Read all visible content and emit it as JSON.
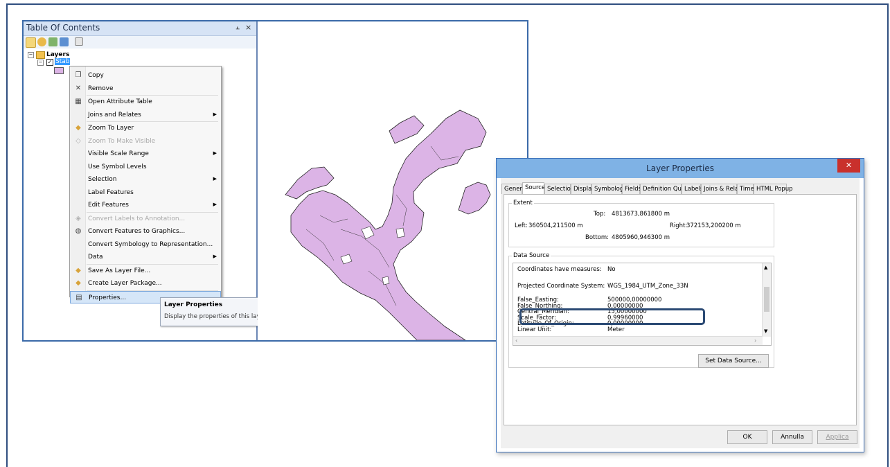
{
  "toc": {
    "title": "Table Of Contents",
    "pin_glyph": "■",
    "close_glyph": "×",
    "layers_label": "Layers",
    "layer_name": "Stab"
  },
  "context_menu": {
    "items": [
      {
        "label": "Copy",
        "icon": "copy-icon",
        "arrow": false,
        "disabled": false
      },
      {
        "label": "Remove",
        "icon": "remove-icon",
        "arrow": false,
        "disabled": false
      },
      {
        "label": "Open Attribute Table",
        "icon": "table-icon",
        "arrow": false,
        "disabled": false
      },
      {
        "label": "Joins and Relates",
        "icon": "",
        "arrow": true,
        "disabled": false
      },
      {
        "label": "Zoom To Layer",
        "icon": "zoom-layer-icon",
        "arrow": false,
        "disabled": false
      },
      {
        "label": "Zoom To Make Visible",
        "icon": "zoom-visible-icon",
        "arrow": false,
        "disabled": true
      },
      {
        "label": "Visible Scale Range",
        "icon": "",
        "arrow": true,
        "disabled": false
      },
      {
        "label": "Use Symbol Levels",
        "icon": "",
        "arrow": false,
        "disabled": false
      },
      {
        "label": "Selection",
        "icon": "",
        "arrow": true,
        "disabled": false
      },
      {
        "label": "Label Features",
        "icon": "",
        "arrow": false,
        "disabled": false
      },
      {
        "label": "Edit Features",
        "icon": "",
        "arrow": true,
        "disabled": false
      },
      {
        "label": "Convert Labels to Annotation...",
        "icon": "convert-labels-icon",
        "arrow": false,
        "disabled": true
      },
      {
        "label": "Convert Features to Graphics...",
        "icon": "convert-features-icon",
        "arrow": false,
        "disabled": false
      },
      {
        "label": "Convert Symbology to Representation...",
        "icon": "",
        "arrow": false,
        "disabled": false
      },
      {
        "label": "Data",
        "icon": "",
        "arrow": true,
        "disabled": false
      },
      {
        "label": "Save As Layer File...",
        "icon": "save-layer-icon",
        "arrow": false,
        "disabled": false
      },
      {
        "label": "Create Layer Package...",
        "icon": "layer-package-icon",
        "arrow": false,
        "disabled": false
      },
      {
        "label": "Properties...",
        "icon": "properties-icon",
        "arrow": false,
        "disabled": false
      }
    ]
  },
  "tooltip": {
    "title": "Layer Properties",
    "text": "Display the properties of this layer"
  },
  "dialog": {
    "title": "Layer Properties",
    "close_glyph": "✕",
    "tabs": [
      "General",
      "Source",
      "Selection",
      "Display",
      "Symbology",
      "Fields",
      "Definition Query",
      "Labels",
      "Joins & Relates",
      "Time",
      "HTML Popup"
    ],
    "active_tab": "Source",
    "extent": {
      "label": "Extent",
      "top_label": "Top:",
      "top": "4813673,861800 m",
      "left_label": "Left:",
      "left": "360504,211500 m",
      "right_label": "Right:",
      "right": "372153,200200 m",
      "bottom_label": "Bottom:",
      "bottom": "4805960,946300 m"
    },
    "data_source": {
      "label": "Data Source",
      "rows": [
        {
          "key": "Coordinates have measures:",
          "value": "No"
        },
        {
          "key": "Projected Coordinate System:",
          "value": "WGS_1984_UTM_Zone_33N"
        },
        {
          "key": "False_Easting:",
          "value": "500000,00000000"
        },
        {
          "key": "False_Northing:",
          "value": "0,00000000"
        },
        {
          "key": "Central_Meridian:",
          "value": "15,00000000"
        },
        {
          "key": "Scale_Factor:",
          "value": "0,99960000"
        },
        {
          "key": "Latitude_Of_Origin:",
          "value": "0,00000000"
        },
        {
          "key": "Linear Unit:",
          "value": "Meter"
        }
      ],
      "set_button": "Set Data Source..."
    },
    "buttons": {
      "ok": "OK",
      "cancel": "Annulla",
      "apply": "Applica"
    }
  },
  "colors": {
    "accent": "#3a6fb8",
    "polygon_fill": "#dcb4e6",
    "highlight": "#2b4a74"
  }
}
